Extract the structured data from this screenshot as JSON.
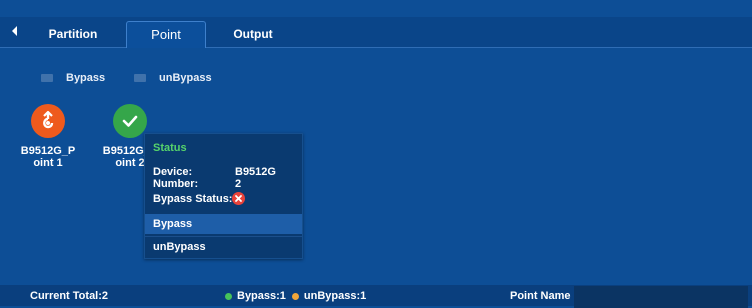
{
  "tabs": {
    "partition": "Partition",
    "point": "Point",
    "output": "Output"
  },
  "actions": {
    "bypass": "Bypass",
    "unbypass": "unBypass"
  },
  "points": [
    {
      "label": "B9512G_P oint 1",
      "state": "bypass",
      "color": "#ee5a1d"
    },
    {
      "label": "B9512G_P oint 2",
      "state": "normal",
      "color": "#35a64a"
    }
  ],
  "popup": {
    "title": "Status",
    "device_key": "Device:",
    "device_val": "B9512G",
    "number_key": "Number:",
    "number_val": "2",
    "bypass_status_key": "Bypass Status:",
    "menu_bypass": "Bypass",
    "menu_unbypass": "unBypass"
  },
  "statusbar": {
    "current_total": "Current Total:2",
    "bypass_count": "Bypass:1",
    "unbypass_count": "unBypass:1",
    "point_name_label": "Point Name",
    "point_name_value": ""
  },
  "colors": {
    "background": "#0d4e96",
    "status_title": "#56d36b",
    "bypass_dot": "#46c35a",
    "unbypass_dot": "#f0a63a",
    "error": "#e8423a"
  }
}
